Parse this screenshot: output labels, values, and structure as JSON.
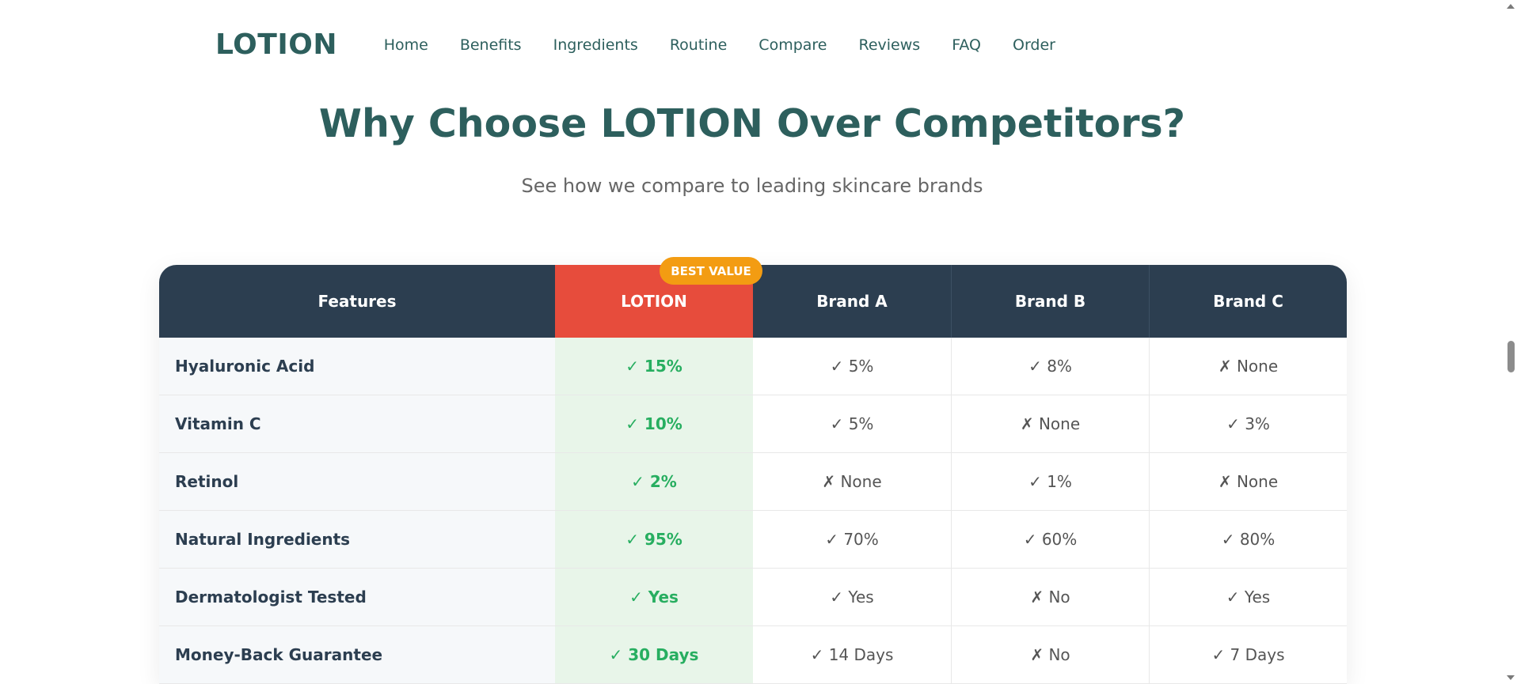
{
  "nav": {
    "logo": "LOTION",
    "links": [
      "Home",
      "Benefits",
      "Ingredients",
      "Routine",
      "Compare",
      "Reviews",
      "FAQ",
      "Order"
    ]
  },
  "section": {
    "title": "Why Choose LOTION Over Competitors?",
    "subtitle": "See how we compare to leading skincare brands"
  },
  "table": {
    "badge": "BEST VALUE",
    "headers": [
      "Features",
      "LOTION",
      "Brand A",
      "Brand B",
      "Brand C"
    ],
    "rows": [
      {
        "feature": "Hyaluronic Acid",
        "lotion": "✓ 15%",
        "brand_a": "✓ 5%",
        "brand_b": "✓ 8%",
        "brand_c": "✗ None"
      },
      {
        "feature": "Vitamin C",
        "lotion": "✓ 10%",
        "brand_a": "✓ 5%",
        "brand_b": "✗ None",
        "brand_c": "✓ 3%"
      },
      {
        "feature": "Retinol",
        "lotion": "✓ 2%",
        "brand_a": "✗ None",
        "brand_b": "✓ 1%",
        "brand_c": "✗ None"
      },
      {
        "feature": "Natural Ingredients",
        "lotion": "✓ 95%",
        "brand_a": "✓ 70%",
        "brand_b": "✓ 60%",
        "brand_c": "✓ 80%"
      },
      {
        "feature": "Dermatologist Tested",
        "lotion": "✓ Yes",
        "brand_a": "✓ Yes",
        "brand_b": "✗ No",
        "brand_c": "✓ Yes"
      },
      {
        "feature": "Money-Back Guarantee",
        "lotion": "✓ 30 Days",
        "brand_a": "✓ 14 Days",
        "brand_b": "✗ No",
        "brand_c": "✓ 7 Days"
      }
    ]
  },
  "colors": {
    "brand": "#2d5f5d",
    "header_bg": "#2c3e50",
    "highlight": "#e74c3c",
    "badge": "#f39c12",
    "check_green": "#27ae60"
  }
}
